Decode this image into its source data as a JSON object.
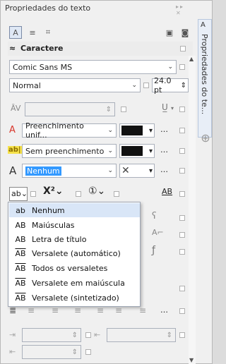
{
  "window": {
    "title": "Propriedades do texto",
    "dock_tab_label": "Propriedades do te..."
  },
  "section": {
    "label": "Caractere"
  },
  "font": {
    "family": "Comic Sans MS",
    "style": "Normal",
    "size": "24.0 pt"
  },
  "fill": {
    "text_fill": "Preenchimento unif...",
    "background_fill": "Sem preenchimento",
    "outline": "Nenhum"
  },
  "dropdown": {
    "items": [
      {
        "glyph": "ab",
        "label": "Nenhum"
      },
      {
        "glyph": "AB",
        "label": "Maiúsculas"
      },
      {
        "glyph": "AB",
        "label": "Letra de título"
      },
      {
        "glyph": "AB",
        "label": "Versalete (automático)"
      },
      {
        "glyph": "AB",
        "label": "Todos os versaletes"
      },
      {
        "glyph": "AB",
        "label": "Versalete em maiúscula"
      },
      {
        "glyph": "AB",
        "label": "Versalete (sintetizado)"
      }
    ]
  },
  "colors": {
    "selection": "#3399ff",
    "dock_tab": "#e8eef7"
  }
}
